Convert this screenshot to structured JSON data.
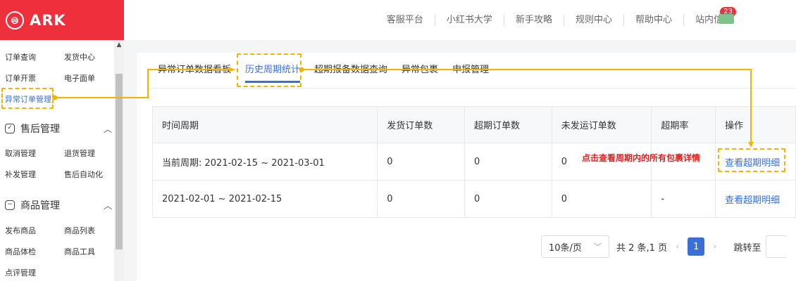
{
  "brand": {
    "logo_glyph": "⊜",
    "name": "ARK",
    "color": "#ee2f3c"
  },
  "topnav": {
    "items": [
      "客服平台",
      "小红书大学",
      "新手攻略",
      "规则中心",
      "帮助中心",
      "站内信"
    ],
    "inbox_badge": "23"
  },
  "sidebar": {
    "order_items": [
      "订单查询",
      "发货中心",
      "订单开票",
      "电子面单",
      "异常订单管理"
    ],
    "aftersale": {
      "title": "售后管理",
      "items": [
        "取消管理",
        "退货管理",
        "补发管理",
        "售后自动化"
      ]
    },
    "goods": {
      "title": "商品管理",
      "items": [
        "发布商品",
        "商品列表",
        "商品体检",
        "商品工具",
        "点评管理"
      ]
    }
  },
  "tabs": [
    "异常订单数据看板",
    "历史周期统计",
    "超期报备数据查询",
    "异常包裹",
    "申报管理"
  ],
  "table": {
    "headers": [
      "时间周期",
      "发货订单数",
      "超期订单数",
      "未发运订单数",
      "超期率",
      "操作"
    ],
    "rows": [
      [
        "当前周期:  2021-02-15 ~ 2021-03-01",
        "0",
        "0",
        "0",
        "",
        "查看超期明细"
      ],
      [
        "2021-02-01 ~ 2021-02-15",
        "0",
        "0",
        "0",
        "-",
        "查看超期明细"
      ]
    ]
  },
  "annotation": "点击查看周期内的所有包裹详情",
  "pagination": {
    "page_size": "10条/页",
    "total": "共 2 条,1 页",
    "current": "1",
    "jump_label": "跳转至"
  },
  "colors": {
    "accent": "#3a6fd8",
    "highlight": "#f2b400",
    "annotation": "#e02020"
  }
}
